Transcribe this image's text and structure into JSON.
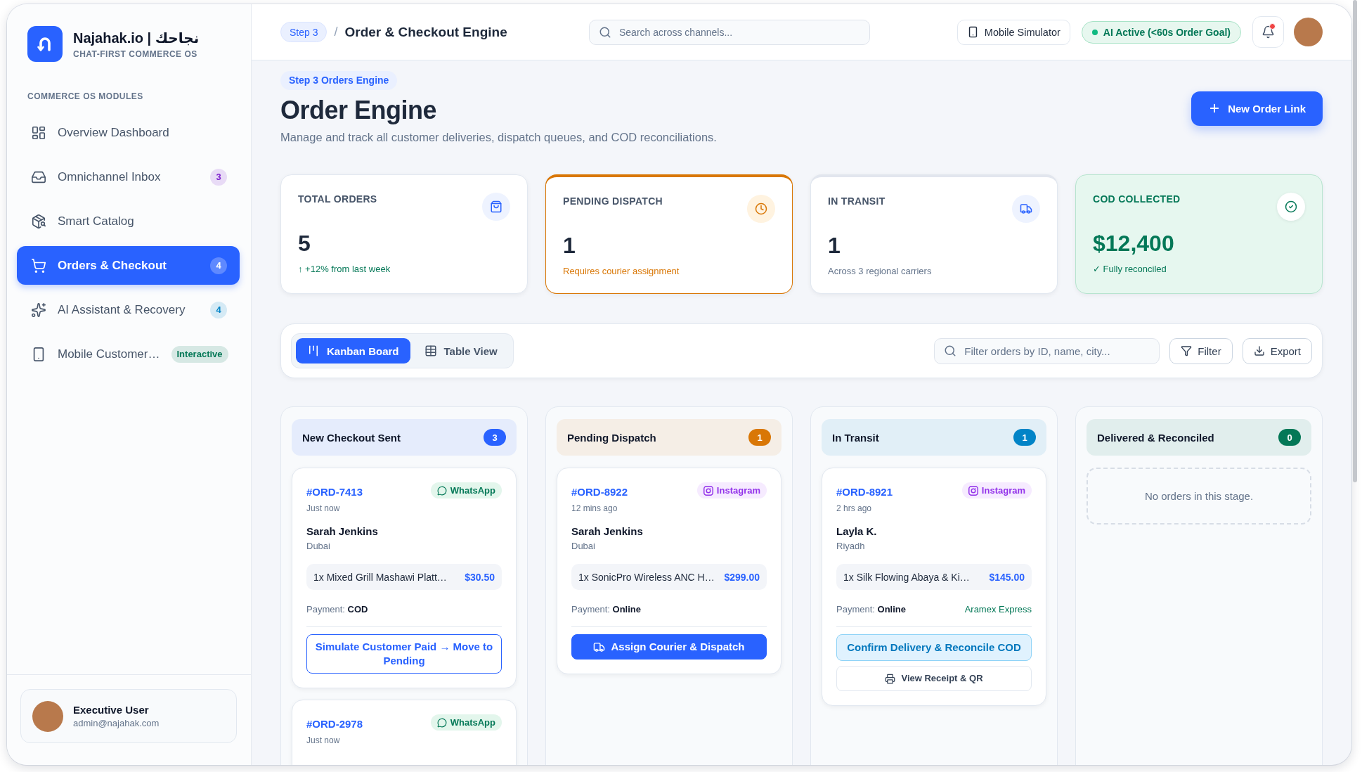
{
  "app": {
    "name": "Najahak.io | نجاحك",
    "tagline": "CHAT-FIRST COMMERCE OS"
  },
  "sidebar": {
    "section_label": "COMMERCE OS MODULES",
    "items": [
      {
        "label": "Overview Dashboard",
        "selected": false
      },
      {
        "label": "Omnichannel Inbox",
        "selected": false,
        "badge": {
          "text": "3",
          "color": "#7e22ce"
        }
      },
      {
        "label": "Smart Catalog",
        "selected": false
      },
      {
        "label": "Orders & Checkout",
        "selected": true,
        "badge": {
          "text": "4",
          "color": "#5f89ff"
        }
      },
      {
        "label": "AI Assistant & Recovery",
        "selected": false,
        "badge": {
          "text": "4",
          "color": "#0284c7"
        }
      },
      {
        "label": "Mobile Customer…",
        "selected": false,
        "badge": {
          "text": "Interactive",
          "color": "#047857"
        }
      }
    ],
    "user": {
      "name": "Executive User",
      "email": "admin@najahak.com"
    }
  },
  "header": {
    "step": "Step 3",
    "separator": "/",
    "title": "Order & Checkout Engine",
    "search": {
      "placeholder": "Search across channels..."
    },
    "simulator_button": "Mobile Simulator",
    "status": "AI Active (<60s Order Goal)",
    "notifications": {
      "unread": true
    }
  },
  "page": {
    "eyebrow": "Step 3 Orders Engine",
    "title": "Order Engine",
    "subtitle": "Manage and track all customer deliveries, dispatch queues, and COD reconciliations.",
    "primary_action": "New Order Link"
  },
  "stats": [
    {
      "kind": "total",
      "label": "TOTAL ORDERS",
      "value": "5",
      "note": "↑ +12% from last week"
    },
    {
      "kind": "pending",
      "label": "PENDING DISPATCH",
      "value": "1",
      "note": "Requires courier assignment"
    },
    {
      "kind": "transit",
      "label": "IN TRANSIT",
      "value": "1",
      "note": "Across 3 regional carriers"
    },
    {
      "kind": "collected",
      "label": "COD COLLECTED",
      "value": "$12,400",
      "note": "✓ Fully reconciled"
    }
  ],
  "toolbar": {
    "views": [
      {
        "label": "Kanban Board",
        "selected": true
      },
      {
        "label": "Table View",
        "selected": false
      }
    ],
    "filter": {
      "placeholder": "Filter orders by ID, name, city..."
    },
    "buttons": [
      "Filter",
      "Export"
    ]
  },
  "board": {
    "columns": [
      {
        "title": "New Checkout Sent",
        "count": "3",
        "color": "#2962ff",
        "orders": [
          {
            "id": "#ORD-7413",
            "time": "Just now",
            "channel": {
              "name": "WhatsApp",
              "kind": "whatsapp"
            },
            "customer": "Sarah Jenkins",
            "city": "Dubai",
            "item": "1x Mixed Grill Mashawi Platt…",
            "price": "$30.50",
            "payment": "Payment: **COD**",
            "actions": [
              {
                "label": "Simulate Customer Paid → Move to Pending",
                "kind": "outline"
              }
            ]
          },
          {
            "id": "#ORD-2978",
            "time": "Just now",
            "channel": {
              "name": "WhatsApp",
              "kind": "whatsapp"
            }
          }
        ]
      },
      {
        "title": "Pending Dispatch",
        "count": "1",
        "color": "#d97706",
        "orders": [
          {
            "id": "#ORD-8922",
            "time": "12 mins ago",
            "channel": {
              "name": "Instagram",
              "kind": "instagram"
            },
            "customer": "Sarah Jenkins",
            "city": "Dubai",
            "item": "1x SonicPro Wireless ANC H…",
            "price": "$299.00",
            "payment": "Payment: **Online**",
            "actions": [
              {
                "label": "Assign Courier & Dispatch",
                "kind": "primary"
              }
            ]
          }
        ]
      },
      {
        "title": "In Transit",
        "count": "1",
        "color": "#0284c7",
        "orders": [
          {
            "id": "#ORD-8921",
            "time": "2 hrs ago",
            "channel": {
              "name": "Instagram",
              "kind": "instagram"
            },
            "customer": "Layla K.",
            "city": "Riyadh",
            "item": "1x Silk Flowing Abaya & Ki…",
            "price": "$145.00",
            "payment": "Payment: **Online**",
            "carrier": "Aramex Express",
            "actions": [
              {
                "label": "Confirm Delivery & Reconcile COD",
                "kind": "soft"
              },
              {
                "label": "View Receipt & QR",
                "kind": "secondary"
              }
            ]
          }
        ]
      },
      {
        "title": "Delivered & Reconciled",
        "count": "0",
        "color": "#047857",
        "empty_text": "No orders in this stage."
      }
    ]
  }
}
